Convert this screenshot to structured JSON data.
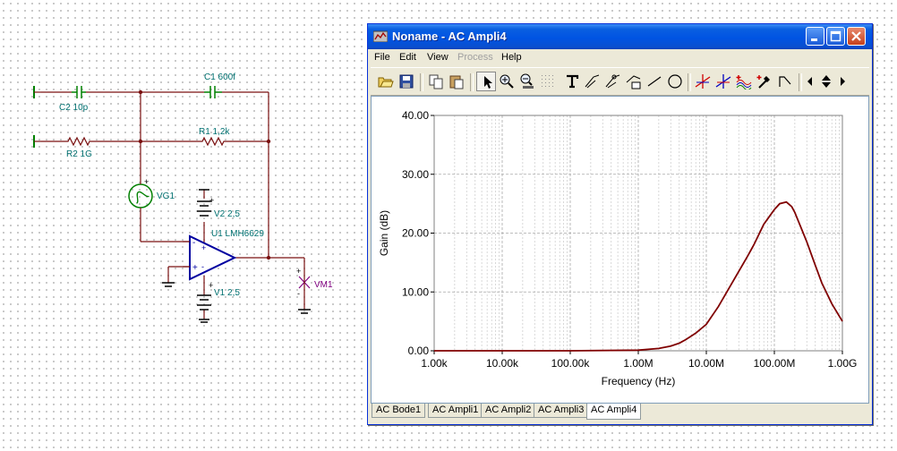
{
  "schematic": {
    "c2_label": "C2 10p",
    "r2_label": "R2 1G",
    "c1_label": "C1 600f",
    "r1_label": "R1 1,2k",
    "vg1_label": "VG1",
    "v2_label": "V2 2,5",
    "u1_label": "U1 LMH6629",
    "v1_label": "V1 2,5",
    "vm1_label": "VM1",
    "plus_sign": "+",
    "minus_sign": "-",
    "colors": {
      "wire": "#7a1010",
      "component": "#007070",
      "opamp": "#0000a0",
      "meter": "#800080"
    }
  },
  "window": {
    "title": "Noname - AC Ampli4",
    "menu": {
      "file": "File",
      "edit": "Edit",
      "view": "View",
      "process": "Process",
      "help": "Help"
    },
    "toolbar": {
      "buttons": [
        "open-icon",
        "save-icon",
        "copy-icon",
        "paste-icon",
        "pointer-icon",
        "zoom-in-icon",
        "zoom-100-icon",
        "grid-icon",
        "text-icon",
        "slope-icon",
        "point-icon",
        "formula-icon",
        "line-icon",
        "ellipse-icon",
        "cursor-a-icon",
        "cursor-b-icon",
        "add-curve-icon",
        "pick-icon",
        "angle-icon",
        "prev-icon",
        "up-down-icon",
        "next-icon"
      ]
    },
    "tabs": [
      {
        "label": "AC Bode1"
      },
      {
        "label": "AC Ampli1"
      },
      {
        "label": "AC Ampli2"
      },
      {
        "label": "AC Ampli3"
      },
      {
        "label": "AC Ampli4"
      }
    ],
    "active_tab": "AC Ampli4"
  },
  "chart_data": {
    "type": "line",
    "title": "",
    "xlabel": "Frequency (Hz)",
    "ylabel": "Gain (dB)",
    "x_scale": "log",
    "xlim": [
      1000,
      1000000000
    ],
    "ylim": [
      0,
      40
    ],
    "x_ticks": [
      "1.00k",
      "10.00k",
      "100.00k",
      "1.00M",
      "10.00M",
      "100.00M",
      "1.00G"
    ],
    "y_ticks": [
      "0.00",
      "10.00",
      "20.00",
      "30.00",
      "40.00"
    ],
    "grid": true,
    "line_color": "#800000",
    "series": [
      {
        "x": [
          1000,
          10000,
          100000,
          1000000,
          2000000,
          3000000,
          4000000,
          5000000,
          7000000,
          10000000,
          15000000,
          20000000,
          30000000,
          40000000,
          50000000,
          70000000,
          100000000,
          120000000,
          150000000,
          180000000,
          200000000,
          300000000,
          400000000,
          500000000,
          700000000,
          1000000000
        ],
        "values": [
          0.0,
          0.0,
          0.0,
          0.1,
          0.4,
          0.8,
          1.3,
          1.9,
          3.0,
          4.5,
          7.5,
          10.0,
          13.5,
          16.0,
          18.0,
          21.5,
          24.0,
          25.0,
          25.3,
          24.5,
          23.5,
          18.5,
          14.5,
          11.5,
          8.0,
          5.0
        ]
      }
    ]
  }
}
